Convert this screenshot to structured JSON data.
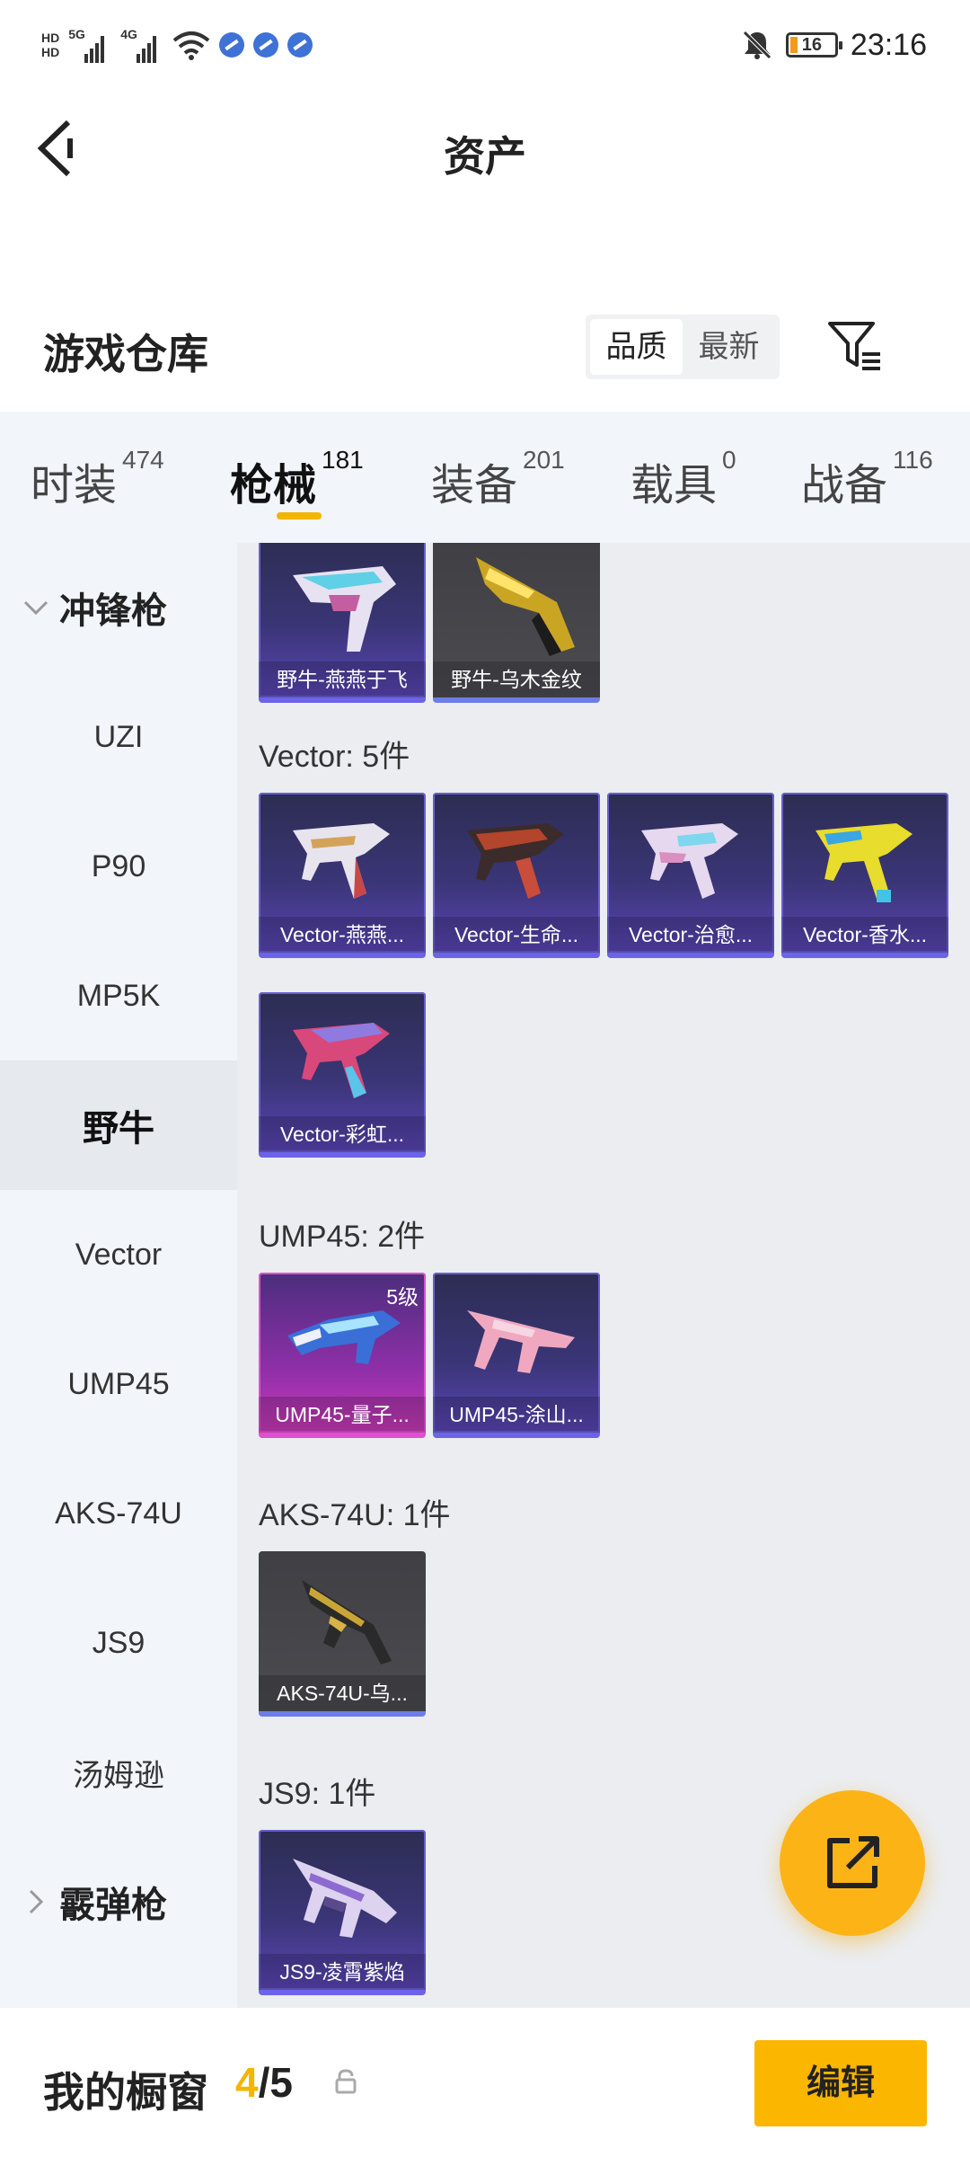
{
  "status_bar": {
    "hd_top": "HD",
    "hd_bottom": "HD",
    "net1": "5G",
    "net2": "4G",
    "battery": "16",
    "time": "23:16"
  },
  "header": {
    "title": "资产"
  },
  "warehouse": {
    "title": "游戏仓库",
    "sort_options": [
      "品质",
      "最新"
    ],
    "sort_selected": "品质"
  },
  "tabs": [
    {
      "label": "时装",
      "count": "474"
    },
    {
      "label": "枪械",
      "count": "181"
    },
    {
      "label": "装备",
      "count": "201"
    },
    {
      "label": "载具",
      "count": "0"
    },
    {
      "label": "战备",
      "count": "116"
    }
  ],
  "active_tab": "枪械",
  "sidebar": {
    "group1": "冲锋枪",
    "items": [
      "UZI",
      "P90",
      "MP5K",
      "野牛",
      "Vector",
      "UMP45",
      "AKS-74U",
      "JS9",
      "汤姆逊"
    ],
    "active_item": "野牛",
    "group2": "霰弹枪"
  },
  "sections": {
    "bizon": {
      "items": [
        {
          "name": "野牛-燕燕于飞",
          "rarity": "purple"
        },
        {
          "name": "野牛-乌木金纹",
          "rarity": "grey"
        }
      ]
    },
    "vector": {
      "label": "Vector: 5件",
      "items": [
        {
          "name": "Vector-燕燕...",
          "rarity": "purple"
        },
        {
          "name": "Vector-生命...",
          "rarity": "purple"
        },
        {
          "name": "Vector-治愈...",
          "rarity": "purple"
        },
        {
          "name": "Vector-香水...",
          "rarity": "purple"
        },
        {
          "name": "Vector-彩虹...",
          "rarity": "purple"
        }
      ]
    },
    "ump45": {
      "label": "UMP45: 2件",
      "items": [
        {
          "name": "UMP45-量子...",
          "rarity": "pink",
          "level": "5级"
        },
        {
          "name": "UMP45-涂山...",
          "rarity": "purple"
        }
      ]
    },
    "aks74u": {
      "label": "AKS-74U: 1件",
      "items": [
        {
          "name": "AKS-74U-乌...",
          "rarity": "grey"
        }
      ]
    },
    "js9": {
      "label": "JS9: 1件",
      "items": [
        {
          "name": "JS9-凌霄紫焰",
          "rarity": "purple"
        }
      ]
    }
  },
  "showcase": {
    "label": "我的橱窗",
    "current": "4",
    "separator": "/",
    "total": "5",
    "edit_label": "编辑"
  },
  "colors": {
    "accent": "#f5b400",
    "purple_rarity": "#6c63e8",
    "pink_rarity": "#e04fd0"
  }
}
